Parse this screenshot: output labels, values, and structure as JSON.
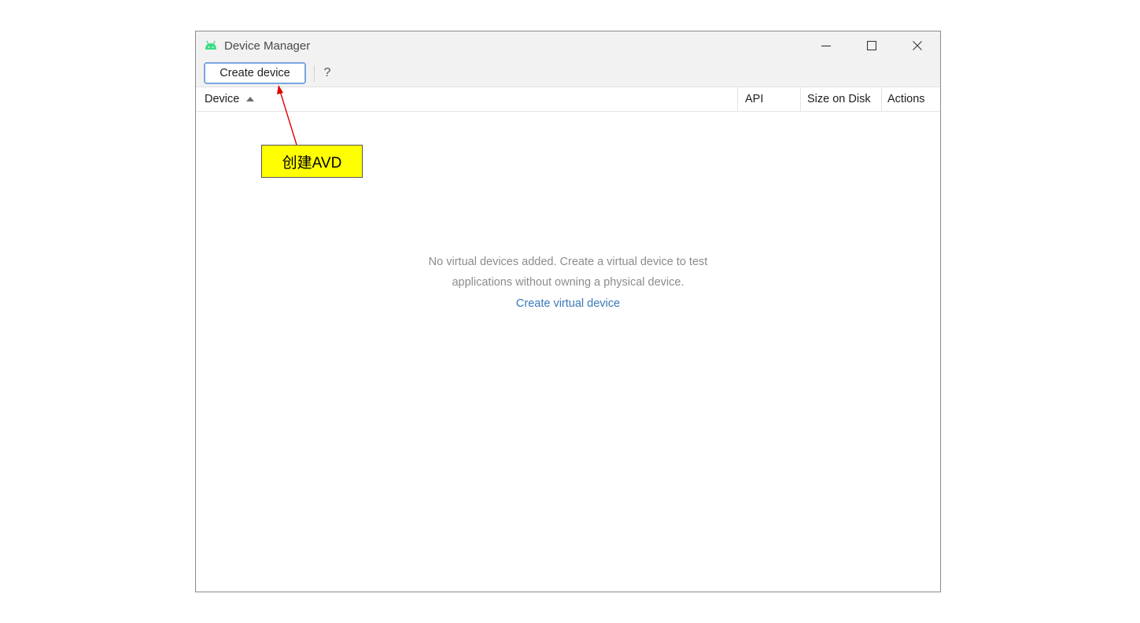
{
  "window": {
    "title": "Device Manager",
    "app_icon": "android-icon",
    "controls": {
      "minimize_icon": "minimize-icon",
      "maximize_icon": "maximize-icon",
      "close_icon": "close-icon"
    }
  },
  "toolbar": {
    "create_label": "Create device",
    "help_label": "?"
  },
  "table": {
    "columns": [
      "Device",
      "API",
      "Size on Disk",
      "Actions"
    ],
    "sorted_column": "Device",
    "sort_direction": "ascending",
    "rows": []
  },
  "empty_state": {
    "line1": "No virtual devices added. Create a virtual device to test",
    "line2": "applications without owning a physical device.",
    "link": "Create virtual device"
  },
  "annotation": {
    "label": "创建AVD",
    "box_color": "#ffff00",
    "arrow_color": "#e00000"
  },
  "colors": {
    "android_green": "#3ddc84",
    "link_blue": "#3a78b8",
    "focus_border": "#7aa7e0"
  }
}
